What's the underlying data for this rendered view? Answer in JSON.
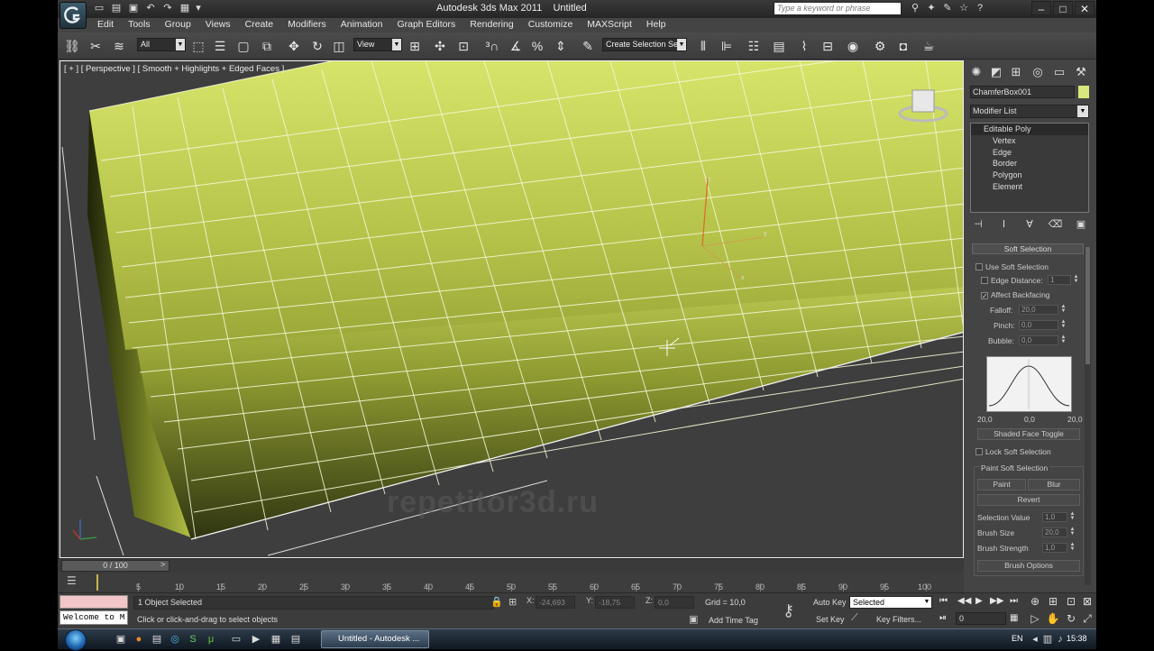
{
  "window": {
    "title": "Autodesk 3ds Max  2011",
    "document": "Untitled",
    "search_placeholder": "Type a keyword or phrase"
  },
  "menu": [
    "Edit",
    "Tools",
    "Group",
    "Views",
    "Create",
    "Modifiers",
    "Animation",
    "Graph Editors",
    "Rendering",
    "Customize",
    "MAXScript",
    "Help"
  ],
  "toolbar": {
    "selection_filter": "All",
    "ref_coord": "View",
    "named_selection": "Create Selection Se"
  },
  "viewport": {
    "label": "[ + ] [ Perspective ] [ Smooth + Highlights + Edged Faces ]",
    "watermark": "repetitor3d.ru",
    "axis_labels": [
      "z",
      "y",
      "x"
    ]
  },
  "command_panel": {
    "object_name": "ChamferBox001",
    "object_color": "#d8e87c",
    "modifier_list": "Modifier List",
    "stack": {
      "top": "Editable Poly",
      "sub": [
        "Vertex",
        "Edge",
        "Border",
        "Polygon",
        "Element"
      ]
    },
    "soft_selection": {
      "title": "Soft Selection",
      "use_soft_selection": "Use Soft Selection",
      "edge_distance": "Edge Distance:",
      "edge_distance_value": "1",
      "affect_backfacing": "Affect Backfacing",
      "falloff": "Falloff:",
      "falloff_value": "20,0",
      "pinch": "Pinch:",
      "pinch_value": "0,0",
      "bubble": "Bubble:",
      "bubble_value": "0,0",
      "curve_left": "20,0",
      "curve_mid": "0,0",
      "curve_right": "20,0",
      "shaded_face_toggle": "Shaded Face Toggle",
      "lock_soft_selection": "Lock Soft Selection",
      "paint_group": "Paint Soft Selection",
      "paint": "Paint",
      "blur": "Blur",
      "revert": "Revert",
      "selection_value": "Selection Value",
      "selection_value_v": "1,0",
      "brush_size": "Brush Size",
      "brush_size_v": "20,0",
      "brush_strength": "Brush Strength",
      "brush_strength_v": "1,0",
      "brush_options": "Brush Options"
    }
  },
  "timeline": {
    "slider": "0 / 100",
    "ticks": [
      "5",
      "10",
      "15",
      "20",
      "25",
      "30",
      "35",
      "40",
      "45",
      "50",
      "55",
      "60",
      "65",
      "70",
      "75",
      "80",
      "85",
      "90",
      "95",
      "100"
    ]
  },
  "status": {
    "selection": "1 Object Selected",
    "prompt": "Click or click-and-drag to select objects",
    "listener": "Welcome to M",
    "x_label": "X:",
    "x_value": "-24,693",
    "y_label": "Y:",
    "y_value": "-18,75",
    "z_label": "Z:",
    "z_value": "0,0",
    "grid": "Grid = 10,0",
    "add_time_tag": "Add Time Tag",
    "auto_key": "Auto Key",
    "set_key": "Set Key",
    "selected": "Selected",
    "key_filters": "Key Filters...",
    "frame": "0"
  },
  "taskbar": {
    "task": "Untitled - Autodesk ...",
    "lang": "EN",
    "clock": "15:38"
  }
}
